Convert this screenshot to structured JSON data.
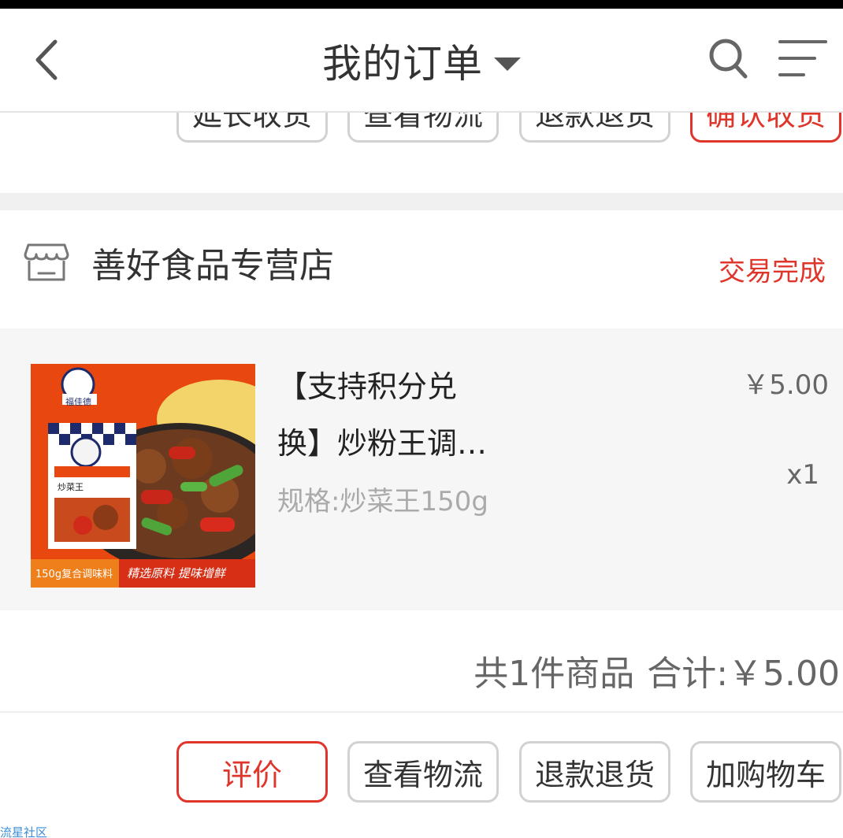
{
  "header": {
    "title": "我的订单"
  },
  "previous_order": {
    "buttons": [
      "延长收货",
      "查看物流",
      "退款退货",
      "确认收货"
    ]
  },
  "order": {
    "shop_name": "善好食品专营店",
    "status": "交易完成",
    "product": {
      "title_line1": "【支持积分兑",
      "title_line2": "换】炒粉王调…",
      "spec": "规格:炒菜王150g",
      "price": "￥5.00",
      "quantity": "x1",
      "image_texts": {
        "brand": "福佳德",
        "pack_label": "炒菜王",
        "weight": "150g复合调味料",
        "slogan": "精选原料 提味增鲜"
      }
    },
    "summary": {
      "count_text": "共1件商品",
      "total_text": "合计:￥5.00"
    },
    "buttons": [
      "评价",
      "查看物流",
      "退款退货",
      "加购物车"
    ]
  },
  "watermark": "流星社区",
  "colors": {
    "accent_red": "#e0352b",
    "border_gray": "#d2d2d2",
    "product_bg": "#f6f6f6"
  }
}
